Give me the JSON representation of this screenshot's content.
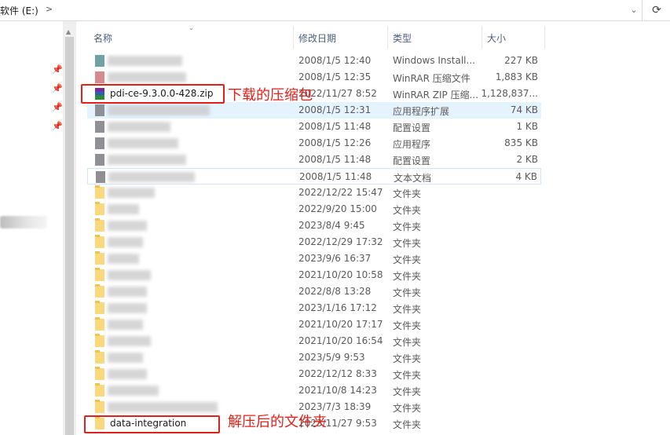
{
  "address_bar": {
    "path_text": "软件 (E:)",
    "separator": ">",
    "dropdown": "⌄",
    "refresh": "⟳"
  },
  "columns": {
    "name": "名称",
    "date_modified": "修改日期",
    "type": "类型",
    "size": "大小"
  },
  "files": [
    {
      "name": "",
      "date": "2008/1/5 12:40",
      "type": "Windows Install...",
      "size": "227 KB",
      "icon": "teal",
      "name_blurred": true
    },
    {
      "name": "",
      "date": "2008/1/5 12:35",
      "type": "WinRAR 压缩文件",
      "size": "1,883 KB",
      "icon": "pink",
      "name_blurred": true
    },
    {
      "name": "pdi-ce-9.3.0.0-428.zip",
      "date": "2022/11/27 8:52",
      "type": "WinRAR ZIP 压缩...",
      "size": "1,128,837...",
      "icon": "rar",
      "name_blurred": false
    },
    {
      "name": "",
      "date": "2008/1/5 12:31",
      "type": "应用程序扩展",
      "size": "74 KB",
      "icon": "gray",
      "name_blurred": true,
      "selected": true
    },
    {
      "name": "",
      "date": "2008/1/5 11:48",
      "type": "配置设置",
      "size": "1 KB",
      "icon": "gray",
      "name_blurred": true
    },
    {
      "name": "",
      "date": "2008/1/5 12:26",
      "type": "应用程序",
      "size": "835 KB",
      "icon": "gray",
      "name_blurred": true
    },
    {
      "name": "",
      "date": "2008/1/5 11:48",
      "type": "配置设置",
      "size": "2 KB",
      "icon": "gray",
      "name_blurred": true
    },
    {
      "name": "",
      "date": "2008/1/5 11:48",
      "type": "文本文档",
      "size": "4 KB",
      "icon": "gray",
      "name_blurred": true,
      "hover": true
    },
    {
      "name": "",
      "date": "2022/12/22 15:47",
      "type": "文件夹",
      "size": "",
      "icon": "folder",
      "name_blurred": true
    },
    {
      "name": "",
      "date": "2022/9/20 15:00",
      "type": "文件夹",
      "size": "",
      "icon": "folder",
      "name_blurred": true
    },
    {
      "name": "",
      "date": "2023/8/4 9:45",
      "type": "文件夹",
      "size": "",
      "icon": "folder",
      "name_blurred": true
    },
    {
      "name": "",
      "date": "2022/12/29 17:32",
      "type": "文件夹",
      "size": "",
      "icon": "folder",
      "name_blurred": true
    },
    {
      "name": "",
      "date": "2023/9/6 16:37",
      "type": "文件夹",
      "size": "",
      "icon": "folder",
      "name_blurred": true
    },
    {
      "name": "",
      "date": "2021/10/20 10:58",
      "type": "文件夹",
      "size": "",
      "icon": "folder",
      "name_blurred": true
    },
    {
      "name": "",
      "date": "2022/8/8 13:28",
      "type": "文件夹",
      "size": "",
      "icon": "folder",
      "name_blurred": true
    },
    {
      "name": "",
      "date": "2023/1/16 17:12",
      "type": "文件夹",
      "size": "",
      "icon": "folder",
      "name_blurred": true
    },
    {
      "name": "",
      "date": "2021/10/20 17:17",
      "type": "文件夹",
      "size": "",
      "icon": "folder",
      "name_blurred": true
    },
    {
      "name": "",
      "date": "2021/10/20 16:54",
      "type": "文件夹",
      "size": "",
      "icon": "folder",
      "name_blurred": true
    },
    {
      "name": "",
      "date": "2023/5/9 9:53",
      "type": "文件夹",
      "size": "",
      "icon": "folder",
      "name_blurred": true
    },
    {
      "name": "",
      "date": "2022/12/12 8:33",
      "type": "文件夹",
      "size": "",
      "icon": "folder",
      "name_blurred": true
    },
    {
      "name": "",
      "date": "2021/10/8 14:23",
      "type": "文件夹",
      "size": "",
      "icon": "folder",
      "name_blurred": true
    },
    {
      "name": "",
      "date": "2023/7/3 18:39",
      "type": "文件夹",
      "size": "",
      "icon": "folder",
      "name_blurred": true
    },
    {
      "name": "data-integration",
      "date": "2023/11/27 9:53",
      "type": "文件夹",
      "size": "",
      "icon": "folder",
      "name_blurred": false
    }
  ],
  "annotations": {
    "zip_label": "下载的压缩包",
    "folder_label": "解压后的文件夹",
    "color": "#e0211a"
  },
  "nav": {
    "pin_icon": "📌"
  }
}
